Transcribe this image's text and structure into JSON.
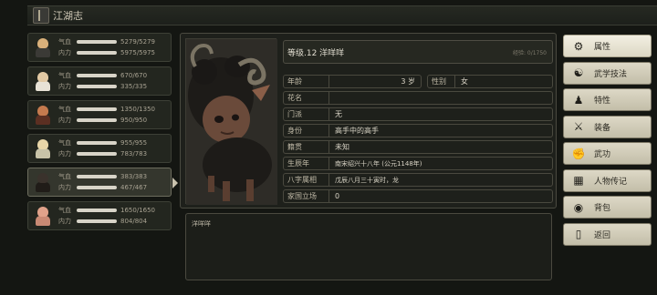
{
  "window": {
    "title": "江湖志"
  },
  "party": [
    {
      "hp_label": "气血",
      "hp": "5279/5279",
      "mp_label": "内力",
      "mp": "5975/5975",
      "hp_frac": 1.0,
      "mp_frac": 1.0,
      "head": "#d9b07a",
      "body": "#3b3a36"
    },
    {
      "hp_label": "气血",
      "hp": "670/670",
      "mp_label": "内力",
      "mp": "335/335",
      "hp_frac": 1.0,
      "mp_frac": 1.0,
      "head": "#e2c9a4",
      "body": "#e8e2d6"
    },
    {
      "hp_label": "气血",
      "hp": "1350/1350",
      "mp_label": "内力",
      "mp": "950/950",
      "hp_frac": 1.0,
      "mp_frac": 1.0,
      "head": "#c57a4e",
      "body": "#5b2f22"
    },
    {
      "hp_label": "气血",
      "hp": "955/955",
      "mp_label": "内力",
      "mp": "783/783",
      "hp_frac": 1.0,
      "mp_frac": 1.0,
      "head": "#e8d6a8",
      "body": "#c8c3a8"
    },
    {
      "hp_label": "气血",
      "hp": "383/383",
      "mp_label": "内力",
      "mp": "467/467",
      "hp_frac": 1.0,
      "mp_frac": 1.0,
      "head": "#3a322c",
      "body": "#201c18"
    },
    {
      "hp_label": "气血",
      "hp": "1650/1650",
      "mp_label": "内力",
      "mp": "804/804",
      "hp_frac": 1.0,
      "mp_frac": 1.0,
      "head": "#e0a28a",
      "body": "#c98a74"
    }
  ],
  "character": {
    "level_name": "等级.12  洋咩咩",
    "exp": "经验: 0/1750",
    "age_label": "年龄",
    "age": "3  岁",
    "gender_label": "性别",
    "gender": "女",
    "rows": [
      {
        "label": "花名",
        "value": ""
      },
      {
        "label": "门派",
        "value": "无"
      },
      {
        "label": "身份",
        "value": "高手中的高手"
      },
      {
        "label": "籍贯",
        "value": "未知"
      },
      {
        "label": "生辰年",
        "value": "南宋绍兴十八年 (公元1148年)"
      },
      {
        "label": "八字属相",
        "value": "戊辰八月三十寅时，龙"
      },
      {
        "label": "家国立场",
        "value": "0"
      }
    ],
    "bio": "洋咩咩"
  },
  "menu": [
    {
      "label": "属性",
      "icon": "settings-icon",
      "glyph": "⚙",
      "active": true
    },
    {
      "label": "武学技法",
      "icon": "martial-arts-icon",
      "glyph": "☯",
      "active": false
    },
    {
      "label": "特性",
      "icon": "person-trait-icon",
      "glyph": "♟",
      "active": false
    },
    {
      "label": "装备",
      "icon": "sword-icon",
      "glyph": "⚔",
      "active": false
    },
    {
      "label": "武功",
      "icon": "kungfu-icon",
      "glyph": "✊",
      "active": false
    },
    {
      "label": "人物传记",
      "icon": "scroll-icon",
      "glyph": "▦",
      "active": false
    },
    {
      "label": "背包",
      "icon": "bag-icon",
      "glyph": "◉",
      "active": false
    },
    {
      "label": "返回",
      "icon": "door-icon",
      "glyph": "▯",
      "active": false
    }
  ]
}
